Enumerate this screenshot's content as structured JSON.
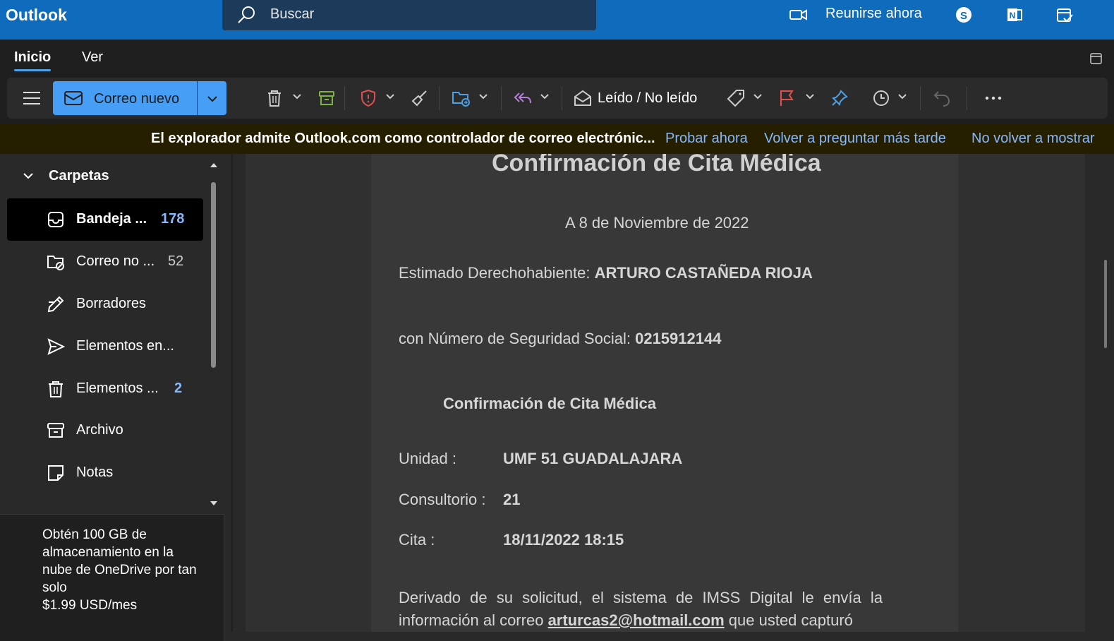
{
  "app": {
    "title": "Outlook"
  },
  "search": {
    "placeholder": "Buscar"
  },
  "header": {
    "meet_label": "Reunirse ahora"
  },
  "tabs": [
    {
      "label": "Inicio",
      "selected": true
    },
    {
      "label": "Ver",
      "selected": false
    }
  ],
  "ribbon": {
    "new_mail_label": "Correo nuevo",
    "read_unread_label": "Leído / No leído"
  },
  "infobar": {
    "message": "El explorador admite Outlook.com como controlador de correo electrónic...",
    "try_now": "Probar ahora",
    "ask_later": "Volver a preguntar más tarde",
    "dont_show": "No volver a mostrar"
  },
  "sidebar": {
    "header": "Carpetas",
    "folders": [
      {
        "name": "Bandeja ...",
        "count": "178",
        "icon": "inbox-icon",
        "selected": true
      },
      {
        "name": "Correo no ...",
        "count": "52",
        "icon": "junk-folder-icon"
      },
      {
        "name": "Borradores",
        "count": "",
        "icon": "drafts-pencil-icon"
      },
      {
        "name": "Elementos en...",
        "count": "",
        "icon": "send-icon"
      },
      {
        "name": "Elementos ...",
        "count": "2",
        "icon": "trash-icon"
      },
      {
        "name": "Archivo",
        "count": "",
        "icon": "archive-icon"
      },
      {
        "name": "Notas",
        "count": "",
        "icon": "note-icon"
      }
    ],
    "promo_text": "Obtén 100 GB de almacenamiento en la nube de OneDrive por tan solo",
    "promo_price": "$1.99 USD/mes"
  },
  "message": {
    "title": "Confirmación de Cita Médica",
    "date": "A 8 de Noviembre de 2022",
    "greeting_label": "Estimado Derechohabiente:",
    "greeting_name": "ARTURO CASTAÑEDA RIOJA",
    "nss_label": "con Número de Seguridad Social:",
    "nss_value": "0215912144",
    "subtitle": "Confirmación de Cita Médica",
    "unit_label": "Unidad :",
    "unit_value": "UMF 51 GUADALAJARA",
    "office_label": "Consultorio :",
    "office_value": "21",
    "appt_label": "Cita :",
    "appt_value": "18/11/2022 18:15",
    "body_line1": "Derivado de su solicitud, el sistema de IMSS Digital le envía la",
    "body_line2_pre": "información al correo",
    "body_line2_email": "arturcas2@hotmail.com",
    "body_line2_post": "que usted capturó"
  },
  "colors": {
    "brand_blue": "#0f6cbd",
    "accent": "#479ef5",
    "link": "#86b7ff",
    "infobar_bg": "#251f00"
  }
}
